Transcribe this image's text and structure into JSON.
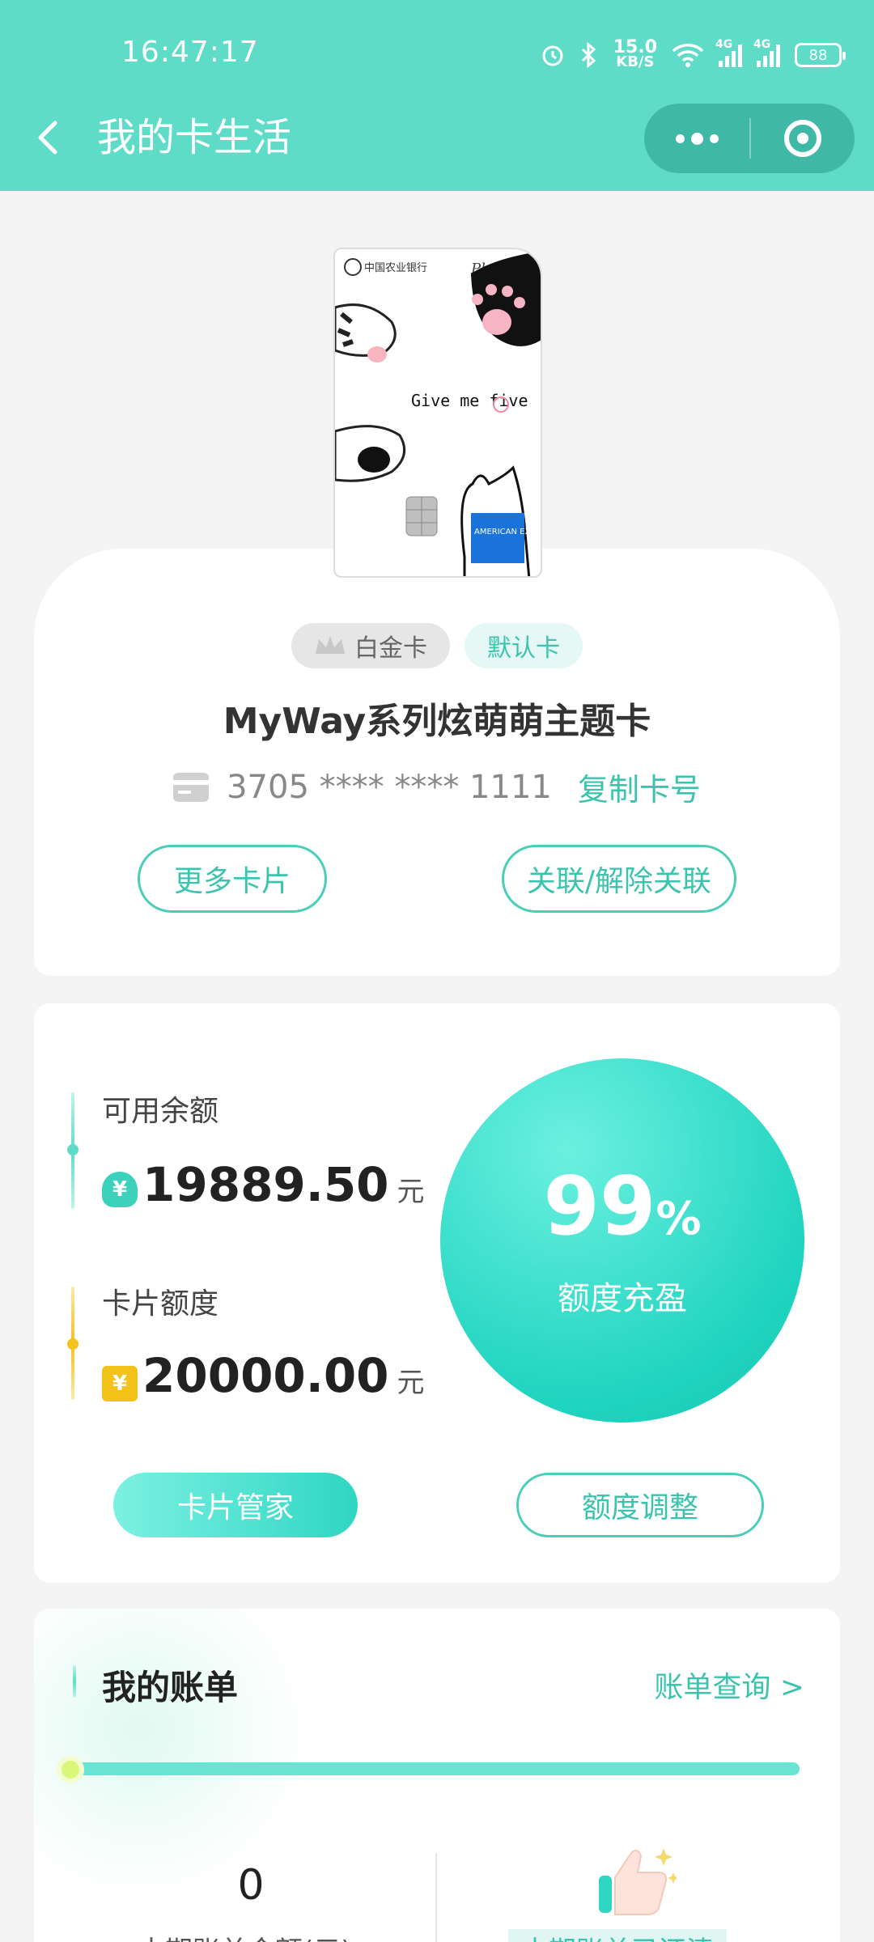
{
  "status_bar": {
    "time": "16:47:17",
    "speed_value": "15.0",
    "speed_unit": "KB/S",
    "signal1": "4G",
    "signal2": "4G",
    "battery": "88"
  },
  "nav": {
    "title": "我的卡生活"
  },
  "card": {
    "image_text": {
      "bank": "中国农业银行",
      "tier": "Platinum",
      "slogan": "Give me five",
      "network": "AMERICAN EXPRESS"
    },
    "badge_tier": "白金卡",
    "badge_default": "默认卡",
    "name": "MyWay系列炫萌萌主题卡",
    "number": "3705 **** **** 1111",
    "copy_label": "复制卡号",
    "more_cards_label": "更多卡片",
    "link_label": "关联/解除关联"
  },
  "balance": {
    "available_label": "可用余额",
    "available_amount": "19889.50",
    "available_unit": "元",
    "limit_label": "卡片额度",
    "limit_amount": "20000.00",
    "limit_unit": "元",
    "percent": "99",
    "percent_sign": "%",
    "status": "额度充盈",
    "manager_label": "卡片管家",
    "adjust_label": "额度调整",
    "coin_symbol": "¥"
  },
  "bill": {
    "title": "我的账单",
    "query_label": "账单查询 >",
    "amount": "0",
    "amount_label": "本期账单金额(元)",
    "status_label": "本期账单已还清"
  },
  "colors": {
    "accent": "#5fdcc8",
    "accent_text": "#3cc3ae",
    "capsule": "#3fb9a5",
    "yellow": "#f3c21b"
  }
}
